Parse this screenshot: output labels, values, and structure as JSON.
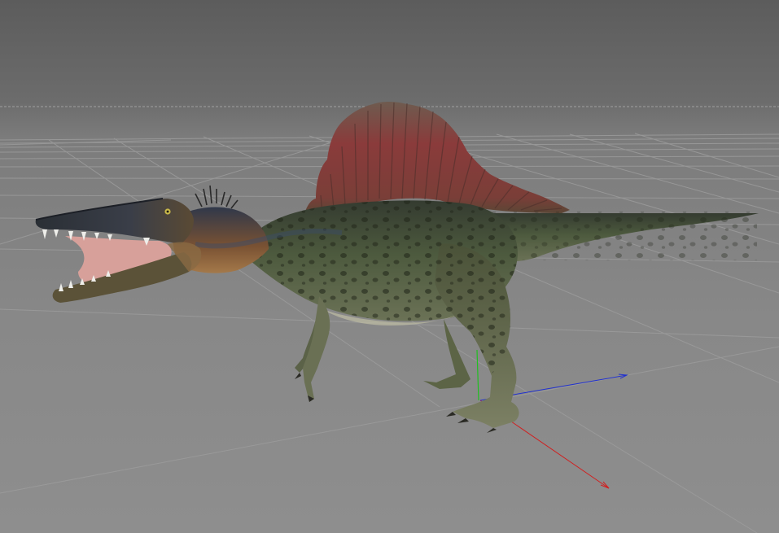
{
  "viewport": {
    "background_top": "#5c5c5c",
    "background_bottom": "#8e8e8e",
    "horizon_line_color": "#a0a0a0",
    "grid_color": "#9c9c9c"
  },
  "axes": {
    "x_axis_color": "#d02020",
    "y_axis_color": "#20c020",
    "z_axis_color": "#2030d0"
  },
  "model": {
    "subject": "spinosaurus-model",
    "sail_color": "#8a3b3b",
    "skin_color": "#4d5a3e",
    "belly_color": "#b8b7a0",
    "spot_color": "#1f2418",
    "mouth_color": "#d7a09a"
  }
}
